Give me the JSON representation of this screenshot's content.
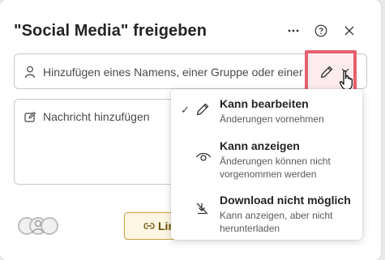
{
  "dialog": {
    "title": "\"Social Media\" freigeben",
    "header_icons": [
      "more-icon",
      "help-icon",
      "close-icon"
    ]
  },
  "people_input": {
    "placeholder": "Hinzufügen eines Namens, einer Gruppe oder einer"
  },
  "message": {
    "placeholder": "Nachricht hinzufügen"
  },
  "footer": {
    "link_button_label": "Lin"
  },
  "permissions": {
    "options": [
      {
        "title": "Kann bearbeiten",
        "description": "Änderungen vornehmen",
        "icon": "pencil-icon",
        "selected": true
      },
      {
        "title": "Kann anzeigen",
        "description": "Änderungen können nicht vorgenommen werden",
        "icon": "eye-icon",
        "selected": false
      },
      {
        "title": "Download nicht möglich",
        "description": "Kann anzeigen, aber nicht herunterladen",
        "icon": "no-download-icon",
        "selected": false
      }
    ]
  },
  "colors": {
    "highlight_border": "#e5606f",
    "link_button_border": "#c8a04c"
  }
}
